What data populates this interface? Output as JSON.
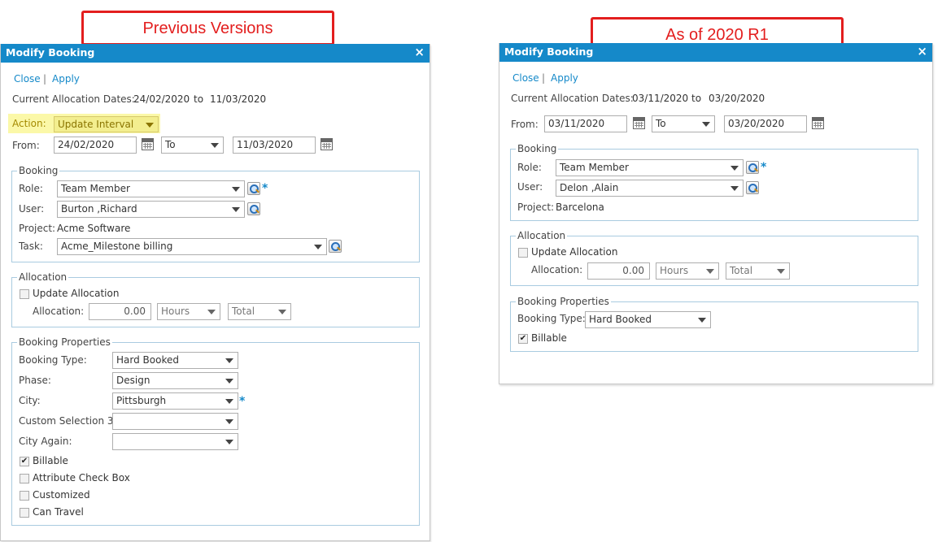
{
  "callouts": {
    "left": "Previous Versions",
    "right": "As of 2020 R1"
  },
  "colors": {
    "titlebar": "#1589c9",
    "callout": "#e31e1e",
    "highlight": "#fbf8a8",
    "link": "#1589c9"
  },
  "left_dialog": {
    "title": "Modify Booking",
    "close_icon": "×",
    "close_link": "Close",
    "separator": "|",
    "apply_link": "Apply",
    "current_dates_label": "Current Allocation Dates:",
    "current_start": "24/02/2020",
    "current_to": "to",
    "current_end": "11/03/2020",
    "action_label": "Action:",
    "action_value": "Update Interval",
    "from_label": "From:",
    "from_value": "24/02/2020",
    "to_select": "To",
    "to_value": "11/03/2020",
    "booking": {
      "legend": "Booking",
      "role_label": "Role:",
      "role_value": "Team Member",
      "user_label": "User:",
      "user_value": "Burton ,Richard",
      "project_label": "Project:",
      "project_value": "Acme Software",
      "task_label": "Task:",
      "task_value": "Acme_Milestone billing",
      "required": "*"
    },
    "allocation": {
      "legend": "Allocation",
      "update_label": "Update Allocation",
      "update_checked": false,
      "alloc_label": "Allocation:",
      "alloc_value": "0.00",
      "unit_value": "Hours",
      "type_value": "Total"
    },
    "properties": {
      "legend": "Booking Properties",
      "booking_type_label": "Booking Type:",
      "booking_type_value": "Hard Booked",
      "phase_label": "Phase:",
      "phase_value": "Design",
      "city_label": "City:",
      "city_value": "Pittsburgh",
      "custom_label": "Custom Selection 3:",
      "custom_value": "",
      "city_again_label": "City Again:",
      "city_again_value": "",
      "checkboxes": [
        {
          "label": "Billable",
          "checked": true
        },
        {
          "label": "Attribute Check Box",
          "checked": false
        },
        {
          "label": "Customized",
          "checked": false
        },
        {
          "label": "Can Travel",
          "checked": false
        }
      ]
    }
  },
  "right_dialog": {
    "title": "Modify Booking",
    "close_icon": "×",
    "close_link": "Close",
    "separator": "|",
    "apply_link": "Apply",
    "current_dates_label": "Current Allocation Dates:",
    "current_start": "03/11/2020",
    "current_to": "to",
    "current_end": "03/20/2020",
    "from_label": "From:",
    "from_value": "03/11/2020",
    "to_select": "To",
    "to_value": "03/20/2020",
    "booking": {
      "legend": "Booking",
      "role_label": "Role:",
      "role_value": "Team Member",
      "user_label": "User:",
      "user_value": "Delon ,Alain",
      "project_label": "Project:",
      "project_value": "Barcelona",
      "required": "*"
    },
    "allocation": {
      "legend": "Allocation",
      "update_label": "Update Allocation",
      "update_checked": false,
      "alloc_label": "Allocation:",
      "alloc_value": "0.00",
      "unit_value": "Hours",
      "type_value": "Total"
    },
    "properties": {
      "legend": "Booking Properties",
      "booking_type_label": "Booking Type:",
      "booking_type_value": "Hard Booked",
      "billable_label": "Billable",
      "billable_checked": true
    }
  }
}
